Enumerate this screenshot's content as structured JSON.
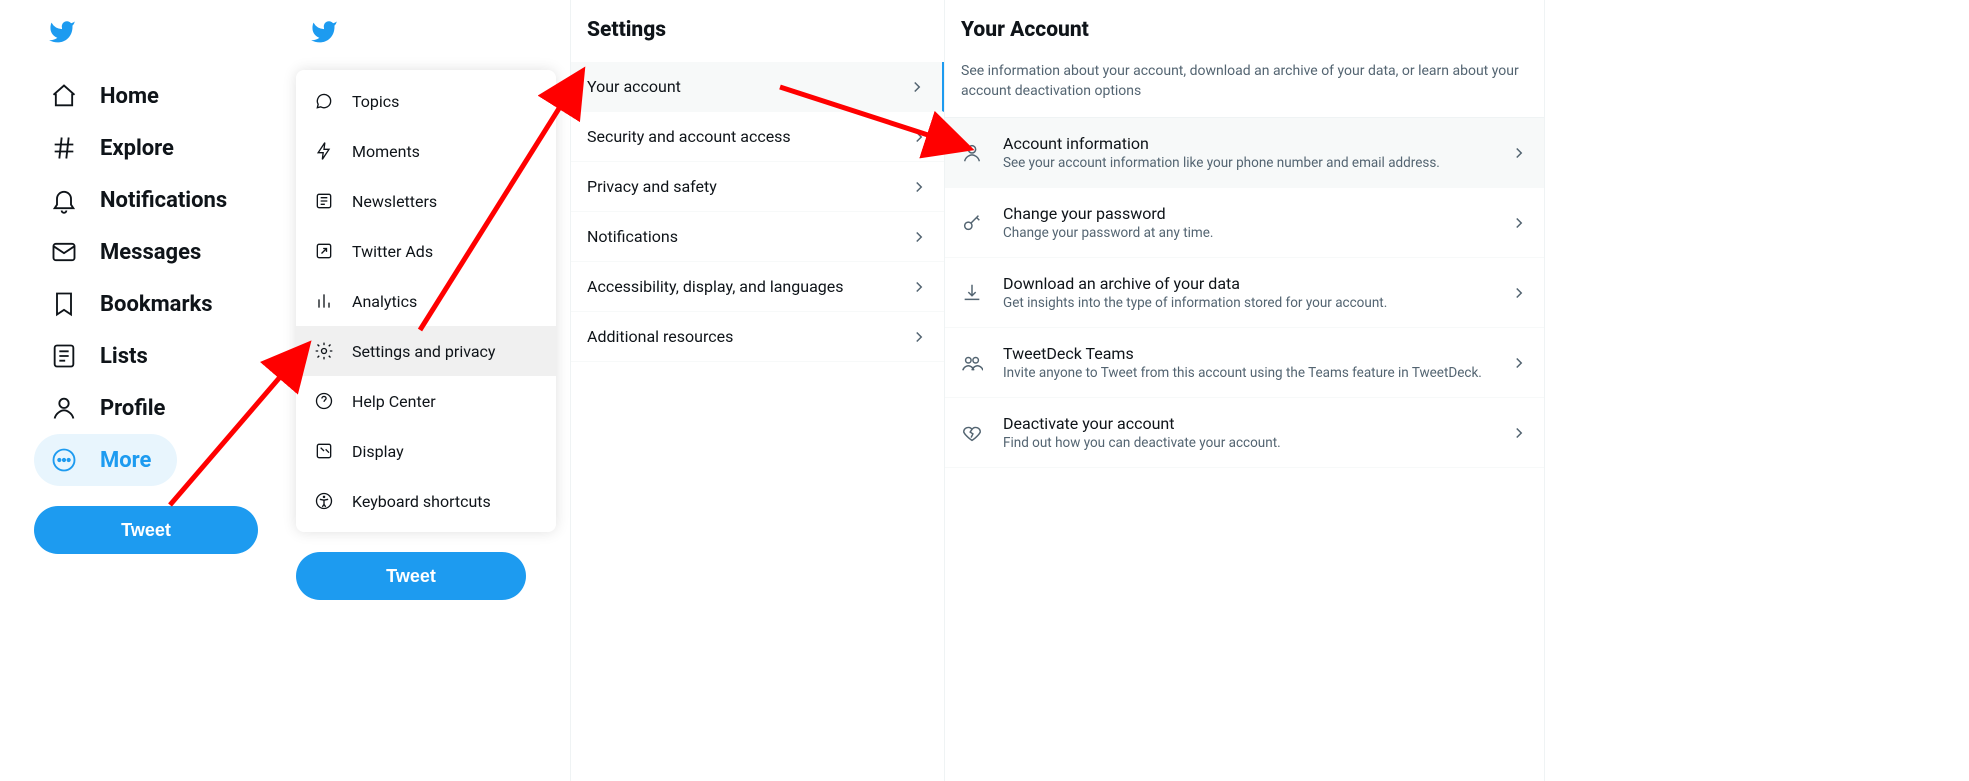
{
  "brand_color": "#1d9bf0",
  "nav": {
    "items": [
      {
        "label": "Home"
      },
      {
        "label": "Explore"
      },
      {
        "label": "Notifications"
      },
      {
        "label": "Messages"
      },
      {
        "label": "Bookmarks"
      },
      {
        "label": "Lists"
      },
      {
        "label": "Profile"
      },
      {
        "label": "More"
      }
    ],
    "tweet_label": "Tweet"
  },
  "more_menu": {
    "items": [
      {
        "label": "Topics"
      },
      {
        "label": "Moments"
      },
      {
        "label": "Newsletters"
      },
      {
        "label": "Twitter Ads"
      },
      {
        "label": "Analytics"
      },
      {
        "label": "Settings and privacy"
      },
      {
        "label": "Help Center"
      },
      {
        "label": "Display"
      },
      {
        "label": "Keyboard shortcuts"
      }
    ],
    "tweet_label": "Tweet"
  },
  "settings": {
    "title": "Settings",
    "items": [
      {
        "label": "Your account"
      },
      {
        "label": "Security and account access"
      },
      {
        "label": "Privacy and safety"
      },
      {
        "label": "Notifications"
      },
      {
        "label": "Accessibility, display, and languages"
      },
      {
        "label": "Additional resources"
      }
    ]
  },
  "account": {
    "title": "Your Account",
    "description": "See information about your account, download an archive of your data, or learn about your account deactivation options",
    "items": [
      {
        "title": "Account information",
        "sub": "See your account information like your phone number and email address."
      },
      {
        "title": "Change your password",
        "sub": "Change your password at any time."
      },
      {
        "title": "Download an archive of your data",
        "sub": "Get insights into the type of information stored for your account."
      },
      {
        "title": "TweetDeck Teams",
        "sub": "Invite anyone to Tweet from this account using the Teams feature in TweetDeck."
      },
      {
        "title": "Deactivate your account",
        "sub": "Find out how you can deactivate your account."
      }
    ]
  }
}
